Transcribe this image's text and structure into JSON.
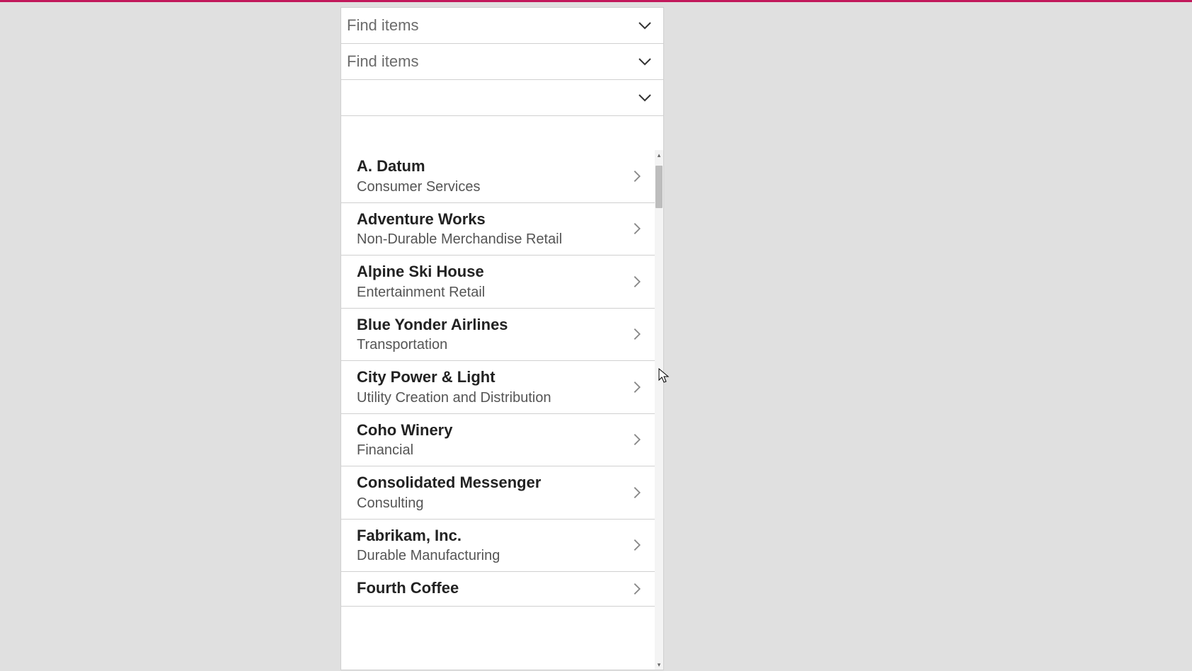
{
  "filters": {
    "placeholder1": "Find items",
    "placeholder2": "Find items",
    "placeholder3": ""
  },
  "items": [
    {
      "title": "A. Datum",
      "sub": "Consumer Services"
    },
    {
      "title": "Adventure Works",
      "sub": "Non-Durable Merchandise Retail"
    },
    {
      "title": "Alpine Ski House",
      "sub": "Entertainment Retail"
    },
    {
      "title": "Blue Yonder Airlines",
      "sub": "Transportation"
    },
    {
      "title": "City Power & Light",
      "sub": "Utility Creation and Distribution"
    },
    {
      "title": "Coho Winery",
      "sub": "Financial"
    },
    {
      "title": "Consolidated Messenger",
      "sub": "Consulting"
    },
    {
      "title": "Fabrikam, Inc.",
      "sub": "Durable Manufacturing"
    },
    {
      "title": "Fourth Coffee",
      "sub": ""
    }
  ]
}
